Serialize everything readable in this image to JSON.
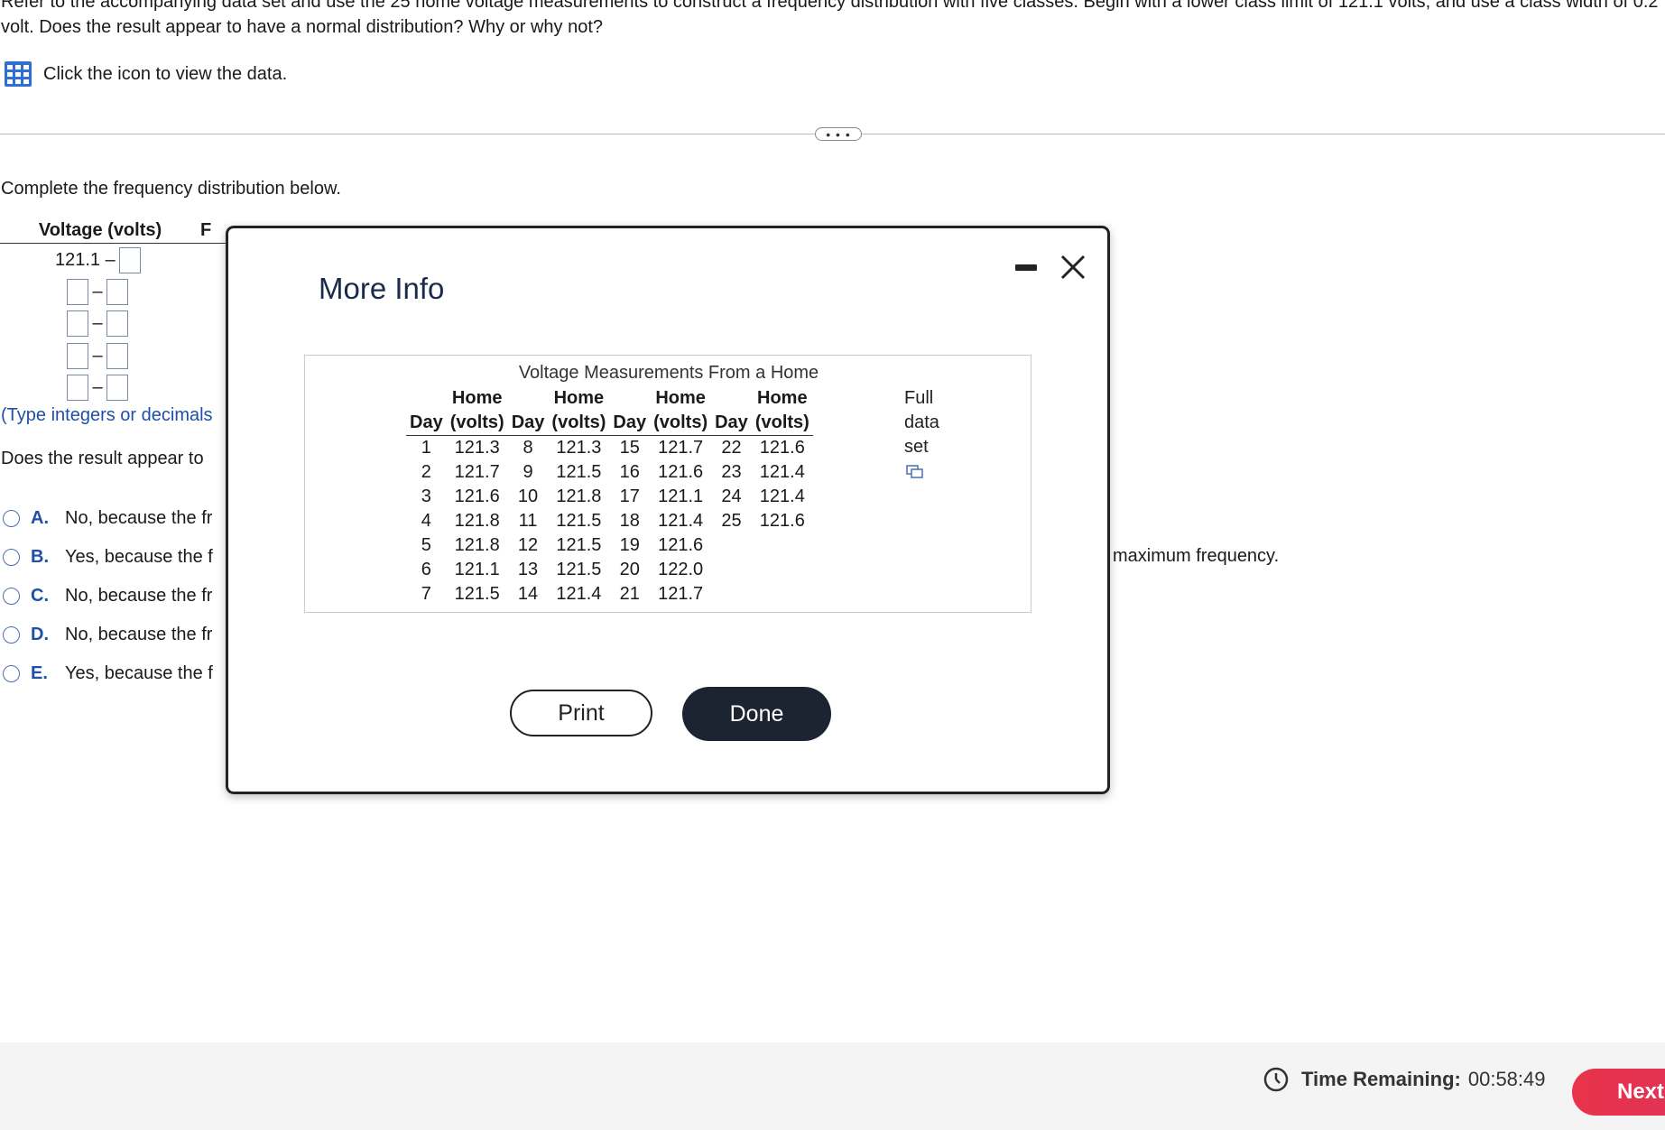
{
  "question": {
    "text": "Refer to the accompanying data set and use the 25 home voltage measurements to construct a frequency distribution with five classes. Begin with a lower class limit of 121.1 volts, and use a class width of 0.2 volt. Does the result appear to have a normal distribution? Why or why not?",
    "data_link": "Click the icon to view the data."
  },
  "expander_label": "• • •",
  "instruction": "Complete the frequency distribution below.",
  "freq_table": {
    "col1_header": "Voltage (volts)",
    "col2_header_partial": "F",
    "first_lower": "121.1 –",
    "dash": "–"
  },
  "hint": "(Type integers or decimals",
  "prompt": "Does the result appear to",
  "options": [
    {
      "letter": "A.",
      "text": "No, because the fr"
    },
    {
      "letter": "B.",
      "text": "Yes, because the f"
    },
    {
      "letter": "C.",
      "text": "No, because the fr"
    },
    {
      "letter": "D.",
      "text": "No, because the fr"
    },
    {
      "letter": "E.",
      "text": "Yes, because the f"
    }
  ],
  "option_b_tail": "maximum frequency.",
  "modal": {
    "title": "More Info",
    "data_title": "Voltage Measurements From a Home",
    "header_top": "Home",
    "header_day": "Day",
    "header_volts": "(volts)",
    "full_data": [
      "Full",
      "data",
      "set"
    ],
    "rows": [
      [
        "1",
        "121.3",
        "8",
        "121.3",
        "15",
        "121.7",
        "22",
        "121.6"
      ],
      [
        "2",
        "121.7",
        "9",
        "121.5",
        "16",
        "121.6",
        "23",
        "121.4"
      ],
      [
        "3",
        "121.6",
        "10",
        "121.8",
        "17",
        "121.1",
        "24",
        "121.4"
      ],
      [
        "4",
        "121.8",
        "11",
        "121.5",
        "18",
        "121.4",
        "25",
        "121.6"
      ],
      [
        "5",
        "121.8",
        "12",
        "121.5",
        "19",
        "121.6",
        "",
        ""
      ],
      [
        "6",
        "121.1",
        "13",
        "121.5",
        "20",
        "122.0",
        "",
        ""
      ],
      [
        "7",
        "121.5",
        "14",
        "121.4",
        "21",
        "121.7",
        "",
        ""
      ]
    ],
    "print_label": "Print",
    "done_label": "Done"
  },
  "footer": {
    "timer_label": "Time Remaining:",
    "timer_value": "00:58:49",
    "next_label": "Next"
  }
}
